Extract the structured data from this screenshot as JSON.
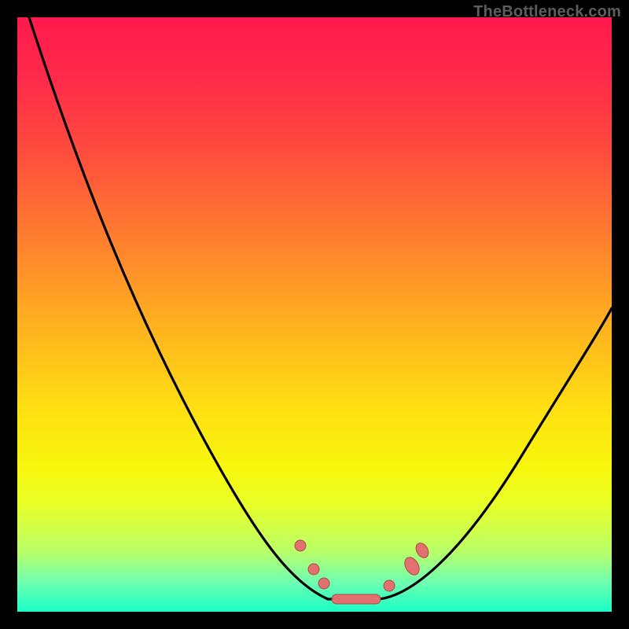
{
  "watermark": "TheBottleneck.com",
  "colors": {
    "frame": "#000000",
    "gradient_top": "#ff1a4d",
    "gradient_mid": "#ffe012",
    "gradient_bottom": "#1affc6",
    "curve": "#000000",
    "marker_fill": "#e27070",
    "marker_stroke": "#b04646"
  },
  "chart_data": {
    "type": "line",
    "title": "",
    "xlabel": "",
    "ylabel": "",
    "xlim": [
      0,
      100
    ],
    "ylim": [
      0,
      100
    ],
    "x": [
      2,
      5,
      10,
      15,
      20,
      25,
      30,
      35,
      40,
      45,
      48,
      50,
      52,
      54,
      56,
      58,
      60,
      62,
      65,
      70,
      75,
      80,
      85,
      90,
      95,
      100
    ],
    "y": [
      100,
      92,
      80,
      69,
      58,
      48,
      39,
      30,
      22,
      14,
      10,
      7,
      5,
      3.5,
      2.5,
      2,
      2,
      2.5,
      4,
      9,
      17,
      26,
      35,
      44,
      51,
      57
    ],
    "markers": [
      {
        "x": 47,
        "y": 11
      },
      {
        "x": 50,
        "y": 7
      },
      {
        "x": 52,
        "y": 5
      },
      {
        "x": 53,
        "y": 3
      },
      {
        "x": 60,
        "y": 2
      },
      {
        "x": 63,
        "y": 3
      },
      {
        "x": 66,
        "y": 6
      },
      {
        "x": 68,
        "y": 9
      }
    ],
    "flat_segment": {
      "x_start": 53,
      "x_end": 60,
      "y": 2
    }
  }
}
